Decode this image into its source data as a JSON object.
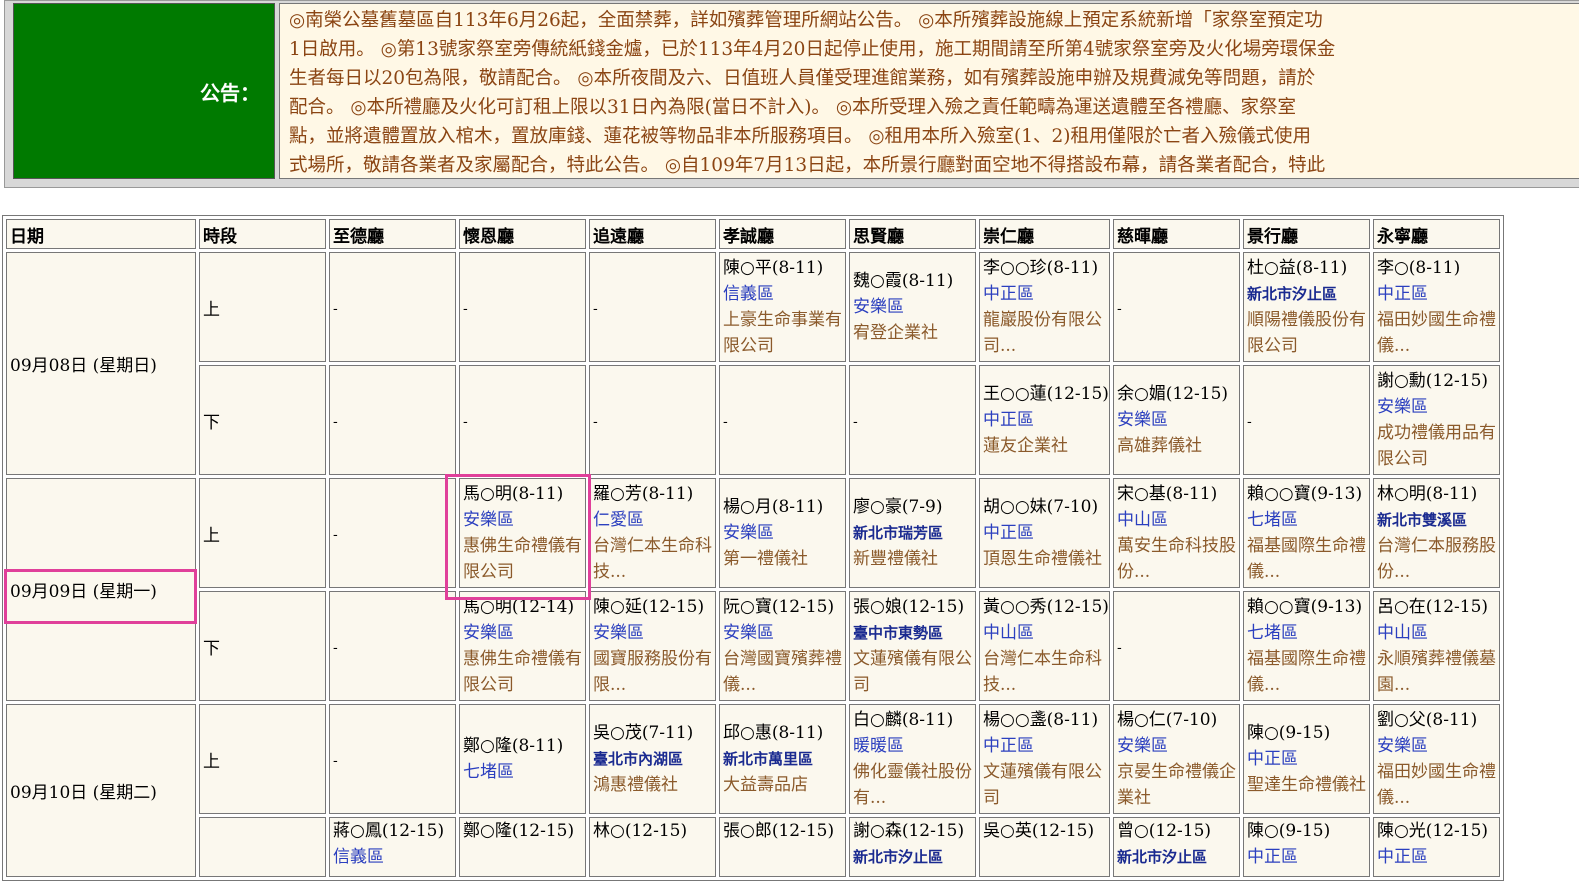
{
  "notice": {
    "label": "公告：",
    "lines": [
      "◎南榮公墓舊墓區自113年6月26起，全面禁葬，詳如殯葬管理所網站公告。 ◎本所殯葬設施線上預定系統新增「家祭室預定功",
      "1日啟用。 ◎第13號家祭室旁傳統紙錢金爐，已於113年4月20日起停止使用，施工期間請至所第4號家祭室旁及火化場旁環保金",
      "生者每日以20包為限，敬請配合。 ◎本所夜間及六、日值班人員僅受理進館業務，如有殯葬設施申辦及規費減免等問題，請於",
      "配合。 ◎本所禮廳及火化可訂租上限以31日內為限(當日不計入)。 ◎本所受理入殮之責任範疇為運送遺體至各禮廳、家祭室",
      "點，並將遺體置放入棺木，置放庫錢、蓮花被等物品非本所服務項目。 ◎租用本所入殮室(1、2)租用僅限於亡者入殮儀式使用",
      "式場所，敬請各業者及家屬配合，特此公告。 ◎自109年7月13日起，本所景行廳對面空地不得搭設布幕，請各業者配合，特此"
    ]
  },
  "schedule": {
    "headers": [
      "日期",
      "時段",
      "至德廳",
      "懷恩廳",
      "追遠廳",
      "孝誠廳",
      "思賢廳",
      "崇仁廳",
      "慈暉廳",
      "景行廳",
      "永寧廳"
    ],
    "days": [
      {
        "date": "09月08日 (星期日)",
        "sessions": [
          {
            "period": "上",
            "cells": [
              null,
              null,
              null,
              {
                "name": "陳○平(8-11)",
                "district": "信義區",
                "company": "上豪生命事業有限公司"
              },
              {
                "name": "魏○霞(8-11)",
                "district": "安樂區",
                "company": "宥登企業社"
              },
              {
                "name": "李○○珍(8-11)",
                "district": "中正區",
                "company": "龍巖股份有限公司..."
              },
              null,
              {
                "name": "杜○益(8-11)",
                "district": "新北市汐止區",
                "company": "順陽禮儀股份有限公司"
              },
              {
                "name": "李○(8-11)",
                "district": "中正區",
                "company": "福田妙國生命禮儀..."
              }
            ]
          },
          {
            "period": "下",
            "cells": [
              null,
              null,
              null,
              null,
              null,
              {
                "name": "王○○蓮(12-15)",
                "district": "中正區",
                "company": "蓮友企業社"
              },
              {
                "name": "余○媚(12-15)",
                "district": "安樂區",
                "company": "高雄葬儀社"
              },
              null,
              {
                "name": "謝○勳(12-15)",
                "district": "安樂區",
                "company": "成功禮儀用品有限公司"
              }
            ]
          }
        ]
      },
      {
        "date": "09月09日 (星期一)",
        "sessions": [
          {
            "period": "上",
            "cells": [
              null,
              {
                "name": "馬○明(8-11)",
                "district": "安樂區",
                "company": "惠佛生命禮儀有限公司"
              },
              {
                "name": "羅○芳(8-11)",
                "district": "仁愛區",
                "company": "台灣仁本生命科技..."
              },
              {
                "name": "楊○月(8-11)",
                "district": "安樂區",
                "company": "第一禮儀社"
              },
              {
                "name": "廖○豪(7-9)",
                "district": "新北市瑞芳區",
                "company": "新豐禮儀社"
              },
              {
                "name": "胡○○妹(7-10)",
                "district": "中正區",
                "company": "頂恩生命禮儀社"
              },
              {
                "name": "宋○基(8-11)",
                "district": "中山區",
                "company": "萬安生命科技股份..."
              },
              {
                "name": "賴○○寶(9-13)",
                "district": "七堵區",
                "company": "福基國際生命禮儀..."
              },
              {
                "name": "林○明(8-11)",
                "district": "新北市雙溪區",
                "company": "台灣仁本服務股份..."
              }
            ]
          },
          {
            "period": "下",
            "cells": [
              null,
              {
                "name": "馬○明(12-14)",
                "district": "安樂區",
                "company": "惠佛生命禮儀有限公司"
              },
              {
                "name": "陳○延(12-15)",
                "district": "安樂區",
                "company": "國寶服務股份有限..."
              },
              {
                "name": "阮○寶(12-15)",
                "district": "安樂區",
                "company": "台灣國寶殯葬禮儀..."
              },
              {
                "name": "張○娘(12-15)",
                "district": "臺中市東勢區",
                "company": "文蓮殯儀有限公司"
              },
              {
                "name": "黃○○秀(12-15)",
                "district": "中山區",
                "company": "台灣仁本生命科技..."
              },
              null,
              {
                "name": "賴○○寶(9-13)",
                "district": "七堵區",
                "company": "福基國際生命禮儀..."
              },
              {
                "name": "呂○在(12-15)",
                "district": "中山區",
                "company": "永順殯葬禮儀墓園..."
              }
            ]
          }
        ]
      },
      {
        "date": "09月10日 (星期二)",
        "sessions": [
          {
            "period": "上",
            "cells": [
              null,
              {
                "name": "鄭○隆(8-11)",
                "district": "七堵區",
                "company": ""
              },
              {
                "name": "吳○茂(7-11)",
                "district": "臺北市內湖區",
                "company": "鴻惠禮儀社"
              },
              {
                "name": "邱○惠(8-11)",
                "district": "新北市萬里區",
                "company": "大益壽品店"
              },
              {
                "name": "白○麟(8-11)",
                "district": "暖暖區",
                "company": "佛化靈儀社股份有..."
              },
              {
                "name": "楊○○盞(8-11)",
                "district": "中正區",
                "company": "文蓮殯儀有限公司"
              },
              {
                "name": "楊○仁(7-10)",
                "district": "安樂區",
                "company": "京晏生命禮儀企業社"
              },
              {
                "name": "陳○(9-15)",
                "district": "中正區",
                "company": "聖達生命禮儀社"
              },
              {
                "name": "劉○父(8-11)",
                "district": "安樂區",
                "company": "福田妙國生命禮儀..."
              }
            ]
          },
          {
            "period": "",
            "cells": [
              {
                "name": "蔣○鳳(12-15)",
                "district": "信義區",
                "company": ""
              },
              {
                "name": "鄭○隆(12-15)",
                "district": "",
                "company": ""
              },
              {
                "name": "林○(12-15)",
                "district": "",
                "company": ""
              },
              {
                "name": "張○郎(12-15)",
                "district": "",
                "company": ""
              },
              {
                "name": "謝○森(12-15)",
                "district": "新北市汐止區",
                "company": ""
              },
              {
                "name": "吳○英(12-15)",
                "district": "",
                "company": ""
              },
              {
                "name": "曾○(12-15)",
                "district": "新北市汐止區",
                "company": ""
              },
              {
                "name": "陳○(9-15)",
                "district": "中正區",
                "company": ""
              },
              {
                "name": "陳○光(12-15)",
                "district": "中正區",
                "company": ""
              }
            ]
          }
        ]
      }
    ],
    "empty_mark": "-"
  },
  "highlight_color": "#e0409a"
}
